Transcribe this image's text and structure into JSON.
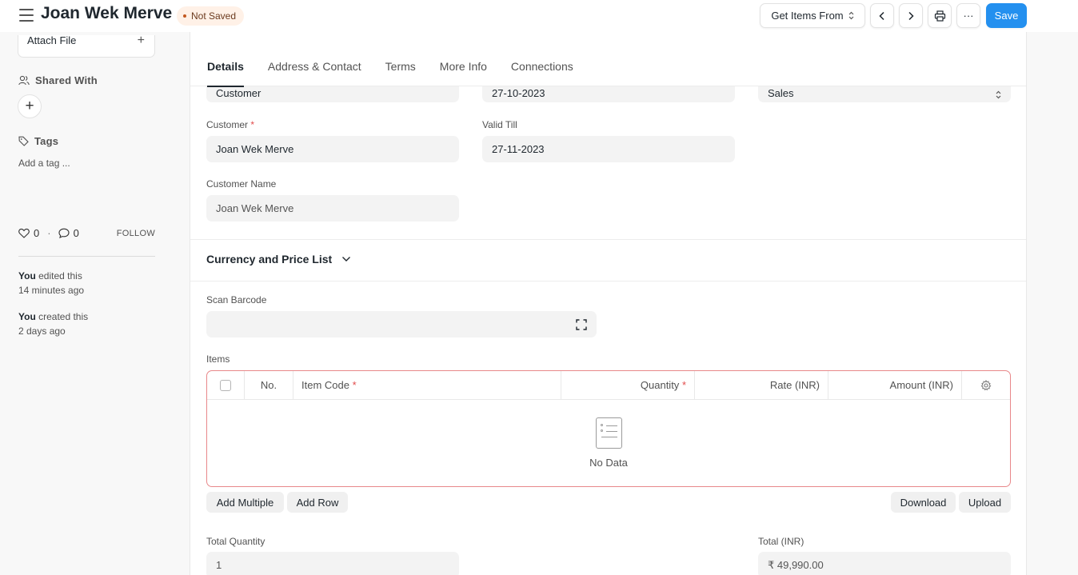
{
  "header": {
    "title": "Joan Wek Merve",
    "status": "Not Saved",
    "get_items_label": "Get Items From",
    "more_label": "···",
    "save_label": "Save",
    "colors": {
      "primary": "#2490ef",
      "indicator_bg": "#fff1e7",
      "indicator_dot": "#c2581f"
    }
  },
  "sidebar": {
    "attach_label": "Attach File",
    "attach_plus": "+",
    "shared_with_label": "Shared With",
    "add_plus": "+",
    "tags_label": "Tags",
    "add_tag_label": "Add a tag ...",
    "likes": "0",
    "comments": "0",
    "separator": "·",
    "follow_label": "FOLLOW",
    "timeline": [
      {
        "who": "You",
        "action": " edited this",
        "when": "14 minutes ago"
      },
      {
        "who": "You",
        "action": " created this",
        "when": "2 days ago"
      }
    ]
  },
  "tabs": [
    "Details",
    "Address & Contact",
    "Terms",
    "More Info",
    "Connections"
  ],
  "form": {
    "quotation_to_value": "Customer",
    "date_value": "27-10-2023",
    "order_type_value": "Sales",
    "customer_label": "Customer",
    "customer_value": "Joan Wek Merve",
    "valid_till_label": "Valid Till",
    "valid_till_value": "27-11-2023",
    "customer_name_label": "Customer Name",
    "customer_name_value": "Joan Wek Merve",
    "required_mark": "*"
  },
  "currency_section": {
    "title": "Currency and Price List"
  },
  "items_section": {
    "scan_barcode_label": "Scan Barcode",
    "items_label": "Items",
    "columns": {
      "no": "No.",
      "item_code": "Item Code",
      "quantity": "Quantity",
      "rate": "Rate (INR)",
      "amount": "Amount (INR)"
    },
    "no_data": "No Data",
    "add_multiple": "Add Multiple",
    "add_row": "Add Row",
    "download": "Download",
    "upload": "Upload"
  },
  "totals": {
    "total_quantity_label": "Total Quantity",
    "total_quantity_value": "1",
    "total_label": "Total (INR)",
    "total_value": "₹ 49,990.00"
  }
}
